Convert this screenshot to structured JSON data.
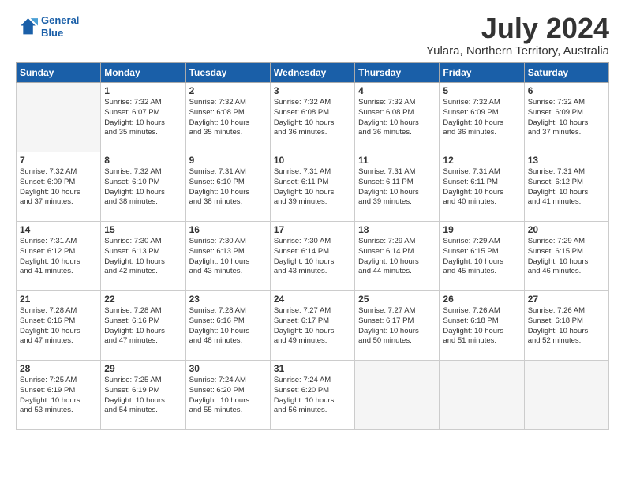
{
  "header": {
    "logo_line1": "General",
    "logo_line2": "Blue",
    "month": "July 2024",
    "location": "Yulara, Northern Territory, Australia"
  },
  "days_of_week": [
    "Sunday",
    "Monday",
    "Tuesday",
    "Wednesday",
    "Thursday",
    "Friday",
    "Saturday"
  ],
  "weeks": [
    [
      {
        "day": "",
        "info": ""
      },
      {
        "day": "1",
        "info": "Sunrise: 7:32 AM\nSunset: 6:07 PM\nDaylight: 10 hours\nand 35 minutes."
      },
      {
        "day": "2",
        "info": "Sunrise: 7:32 AM\nSunset: 6:08 PM\nDaylight: 10 hours\nand 35 minutes."
      },
      {
        "day": "3",
        "info": "Sunrise: 7:32 AM\nSunset: 6:08 PM\nDaylight: 10 hours\nand 36 minutes."
      },
      {
        "day": "4",
        "info": "Sunrise: 7:32 AM\nSunset: 6:08 PM\nDaylight: 10 hours\nand 36 minutes."
      },
      {
        "day": "5",
        "info": "Sunrise: 7:32 AM\nSunset: 6:09 PM\nDaylight: 10 hours\nand 36 minutes."
      },
      {
        "day": "6",
        "info": "Sunrise: 7:32 AM\nSunset: 6:09 PM\nDaylight: 10 hours\nand 37 minutes."
      }
    ],
    [
      {
        "day": "7",
        "info": "Sunrise: 7:32 AM\nSunset: 6:09 PM\nDaylight: 10 hours\nand 37 minutes."
      },
      {
        "day": "8",
        "info": "Sunrise: 7:32 AM\nSunset: 6:10 PM\nDaylight: 10 hours\nand 38 minutes."
      },
      {
        "day": "9",
        "info": "Sunrise: 7:31 AM\nSunset: 6:10 PM\nDaylight: 10 hours\nand 38 minutes."
      },
      {
        "day": "10",
        "info": "Sunrise: 7:31 AM\nSunset: 6:11 PM\nDaylight: 10 hours\nand 39 minutes."
      },
      {
        "day": "11",
        "info": "Sunrise: 7:31 AM\nSunset: 6:11 PM\nDaylight: 10 hours\nand 39 minutes."
      },
      {
        "day": "12",
        "info": "Sunrise: 7:31 AM\nSunset: 6:11 PM\nDaylight: 10 hours\nand 40 minutes."
      },
      {
        "day": "13",
        "info": "Sunrise: 7:31 AM\nSunset: 6:12 PM\nDaylight: 10 hours\nand 41 minutes."
      }
    ],
    [
      {
        "day": "14",
        "info": "Sunrise: 7:31 AM\nSunset: 6:12 PM\nDaylight: 10 hours\nand 41 minutes."
      },
      {
        "day": "15",
        "info": "Sunrise: 7:30 AM\nSunset: 6:13 PM\nDaylight: 10 hours\nand 42 minutes."
      },
      {
        "day": "16",
        "info": "Sunrise: 7:30 AM\nSunset: 6:13 PM\nDaylight: 10 hours\nand 43 minutes."
      },
      {
        "day": "17",
        "info": "Sunrise: 7:30 AM\nSunset: 6:14 PM\nDaylight: 10 hours\nand 43 minutes."
      },
      {
        "day": "18",
        "info": "Sunrise: 7:29 AM\nSunset: 6:14 PM\nDaylight: 10 hours\nand 44 minutes."
      },
      {
        "day": "19",
        "info": "Sunrise: 7:29 AM\nSunset: 6:15 PM\nDaylight: 10 hours\nand 45 minutes."
      },
      {
        "day": "20",
        "info": "Sunrise: 7:29 AM\nSunset: 6:15 PM\nDaylight: 10 hours\nand 46 minutes."
      }
    ],
    [
      {
        "day": "21",
        "info": "Sunrise: 7:28 AM\nSunset: 6:16 PM\nDaylight: 10 hours\nand 47 minutes."
      },
      {
        "day": "22",
        "info": "Sunrise: 7:28 AM\nSunset: 6:16 PM\nDaylight: 10 hours\nand 47 minutes."
      },
      {
        "day": "23",
        "info": "Sunrise: 7:28 AM\nSunset: 6:16 PM\nDaylight: 10 hours\nand 48 minutes."
      },
      {
        "day": "24",
        "info": "Sunrise: 7:27 AM\nSunset: 6:17 PM\nDaylight: 10 hours\nand 49 minutes."
      },
      {
        "day": "25",
        "info": "Sunrise: 7:27 AM\nSunset: 6:17 PM\nDaylight: 10 hours\nand 50 minutes."
      },
      {
        "day": "26",
        "info": "Sunrise: 7:26 AM\nSunset: 6:18 PM\nDaylight: 10 hours\nand 51 minutes."
      },
      {
        "day": "27",
        "info": "Sunrise: 7:26 AM\nSunset: 6:18 PM\nDaylight: 10 hours\nand 52 minutes."
      }
    ],
    [
      {
        "day": "28",
        "info": "Sunrise: 7:25 AM\nSunset: 6:19 PM\nDaylight: 10 hours\nand 53 minutes."
      },
      {
        "day": "29",
        "info": "Sunrise: 7:25 AM\nSunset: 6:19 PM\nDaylight: 10 hours\nand 54 minutes."
      },
      {
        "day": "30",
        "info": "Sunrise: 7:24 AM\nSunset: 6:20 PM\nDaylight: 10 hours\nand 55 minutes."
      },
      {
        "day": "31",
        "info": "Sunrise: 7:24 AM\nSunset: 6:20 PM\nDaylight: 10 hours\nand 56 minutes."
      },
      {
        "day": "",
        "info": ""
      },
      {
        "day": "",
        "info": ""
      },
      {
        "day": "",
        "info": ""
      }
    ]
  ]
}
